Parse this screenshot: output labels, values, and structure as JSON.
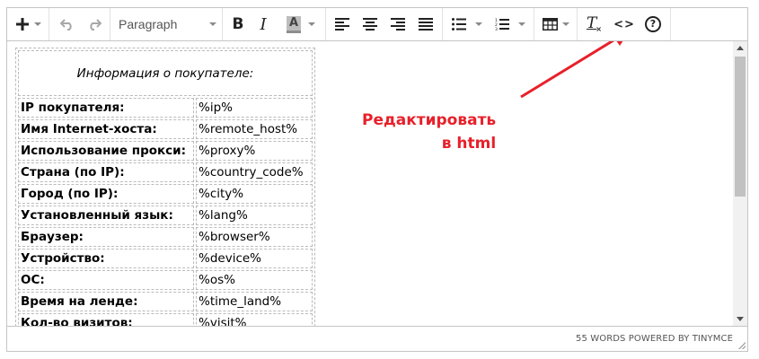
{
  "toolbar": {
    "insert_icon": "plus-icon",
    "undo_icon": "undo-icon",
    "redo_icon": "redo-icon",
    "format_select": "Paragraph",
    "bold_label": "B",
    "italic_label": "I",
    "text_color_label": "A",
    "align_icons": [
      "align-left-icon",
      "align-center-icon",
      "align-right-icon",
      "align-justify-icon"
    ],
    "bullet_list_icon": "bullet-list-icon",
    "numbered_list_icon": "numbered-list-icon",
    "table_icon": "table-icon",
    "clear_format_label": "T",
    "code_label": "<>",
    "help_label": "?"
  },
  "table": {
    "header": "Информация о покупателе:",
    "rows": [
      {
        "label": "IP покупателя:",
        "value": "%ip%"
      },
      {
        "label": "Имя Internet-хоста:",
        "value": "%remote_host%"
      },
      {
        "label": "Использование прокси:",
        "value": "%proxy%"
      },
      {
        "label": "Страна (по IP):",
        "value": "%country_code%"
      },
      {
        "label": "Город (по IP):",
        "value": "%city%"
      },
      {
        "label": "Установленный язык:",
        "value": "%lang%"
      },
      {
        "label": "Браузер:",
        "value": "%browser%"
      },
      {
        "label": "Устройство:",
        "value": "%device%"
      },
      {
        "label": "ОС:",
        "value": "%os%"
      },
      {
        "label": "Время на ленде:",
        "value": "%time_land%"
      },
      {
        "label": "Кол-во визитов:",
        "value": "%visit%"
      }
    ]
  },
  "annotation": {
    "line1": "Редактировать",
    "line2": "в html",
    "color": "#e8202a"
  },
  "statusbar": {
    "wordcount": "55 WORDS POWERED BY TINYMCE"
  }
}
